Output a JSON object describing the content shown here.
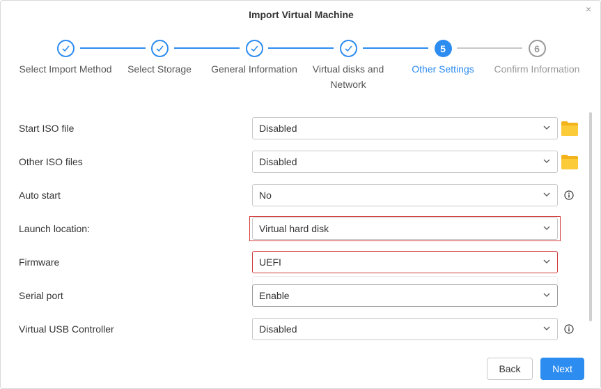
{
  "dialog": {
    "title": "Import Virtual Machine",
    "close_label": "×"
  },
  "steps": [
    {
      "label": "Select Import Method",
      "status": "done",
      "number": ""
    },
    {
      "label": "Select Storage",
      "status": "done",
      "number": ""
    },
    {
      "label": "General Information",
      "status": "done",
      "number": ""
    },
    {
      "label": "Virtual disks and Network",
      "status": "done",
      "number": ""
    },
    {
      "label": "Other Settings",
      "status": "active",
      "number": "5"
    },
    {
      "label": "Confirm Information",
      "status": "todo",
      "number": "6"
    }
  ],
  "form": {
    "rows": [
      {
        "label": "Start ISO file",
        "value": "Disabled"
      },
      {
        "label": "Other ISO files",
        "value": "Disabled"
      },
      {
        "label": "Auto start",
        "value": "No"
      },
      {
        "label": "Launch location:",
        "value": "Virtual hard disk"
      },
      {
        "label": "Firmware",
        "value": "UEFI"
      },
      {
        "label": "Serial port",
        "value": "Enable"
      },
      {
        "label": "Virtual USB Controller",
        "value": "Disabled"
      }
    ]
  },
  "buttons": {
    "back": "Back",
    "next": "Next"
  },
  "colors": {
    "accent": "#2d8cf0",
    "highlight_border": "#d33a3a",
    "folder": "#f7c42a"
  },
  "icons": {
    "step_done": "check-icon",
    "dropdown": "chevron-down-icon",
    "folder": "folder-icon",
    "info": "info-icon",
    "close": "close-icon"
  }
}
